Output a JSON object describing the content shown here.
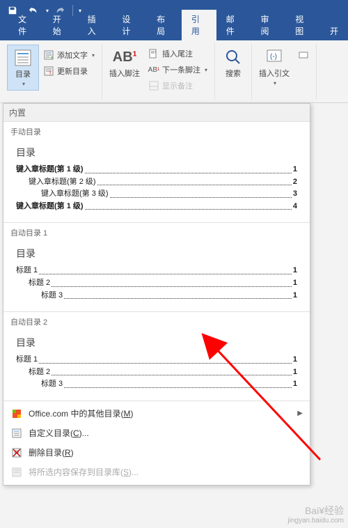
{
  "titlebar": {
    "save": "save",
    "undo": "undo",
    "redo": "redo"
  },
  "tabs": {
    "file": "文件",
    "home": "开始",
    "insert": "插入",
    "design": "设计",
    "layout": "布局",
    "references": "引用",
    "mailings": "邮件",
    "review": "审阅",
    "view": "视图",
    "dev": "开"
  },
  "ribbon": {
    "toc": "目录",
    "add_text": "添加文字",
    "update_toc": "更新目录",
    "insert_footnote": "插入脚注",
    "insert_endnote": "插入尾注",
    "next_footnote": "下一条脚注",
    "show_notes": "显示备注",
    "search": "搜索",
    "insert_citation": "插入引文",
    "ab_sup": "1"
  },
  "dropdown": {
    "header": "内置",
    "manual": {
      "section": "手动目录",
      "title": "目录",
      "l1": "键入章标题(第 1 级)",
      "l2": "键入章标题(第 2 级)",
      "l3": "键入章标题(第 3 级)",
      "l1b": "键入章标题(第 1 级)",
      "p1": "1",
      "p2": "2",
      "p3": "3",
      "p4": "4"
    },
    "auto1": {
      "section": "自动目录 1",
      "title": "目录",
      "h1": "标题 1",
      "h2": "标题 2",
      "h3": "标题 3",
      "p": "1"
    },
    "auto2": {
      "section": "自动目录 2",
      "title": "目录",
      "h1": "标题 1",
      "h2": "标题 2",
      "h3": "标题 3",
      "p": "1"
    },
    "menu": {
      "more_office": "Office.com 中的其他目录(",
      "more_office_m": "M",
      "more_office_end": ")",
      "custom": "自定义目录(",
      "custom_c": "C",
      "custom_end": ")...",
      "remove": "删除目录(",
      "remove_r": "R",
      "remove_end": ")",
      "save_sel": "将所选内容保存到目录库(",
      "save_sel_s": "S",
      "save_sel_end": ")..."
    }
  },
  "watermark": {
    "logo": "Bai¥经验",
    "url": "jingyan.baidu.com"
  }
}
